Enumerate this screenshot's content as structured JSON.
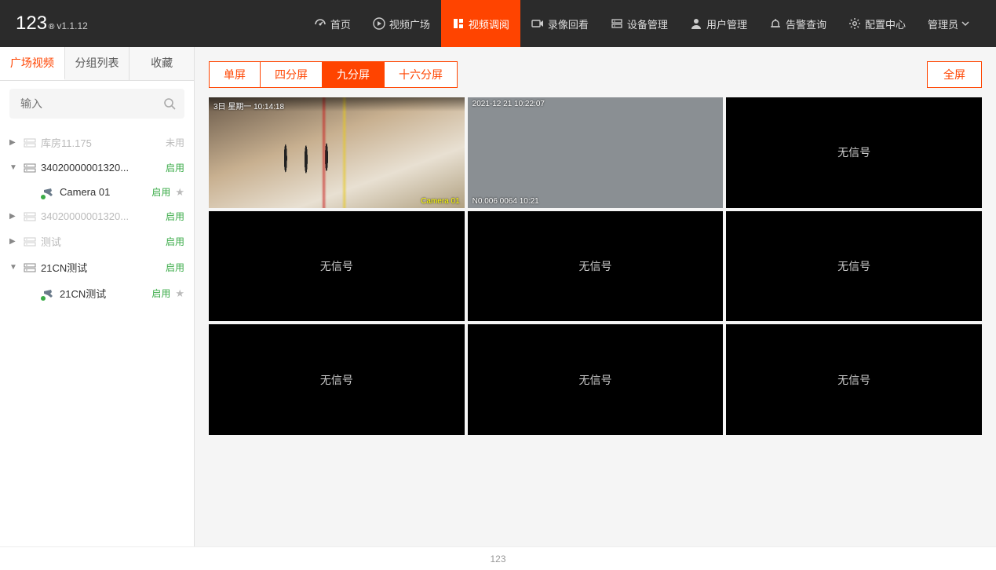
{
  "brand": {
    "name": "123",
    "reg": "®",
    "version": "v1.1.12"
  },
  "nav": {
    "items": [
      {
        "label": "首页",
        "icon": "dashboard"
      },
      {
        "label": "视频广场",
        "icon": "play"
      },
      {
        "label": "视频调阅",
        "icon": "grid",
        "active": true
      },
      {
        "label": "录像回看",
        "icon": "record"
      },
      {
        "label": "设备管理",
        "icon": "device"
      },
      {
        "label": "用户管理",
        "icon": "user"
      },
      {
        "label": "告警查询",
        "icon": "alarm"
      },
      {
        "label": "配置中心",
        "icon": "gear"
      }
    ],
    "user_label": "管理员"
  },
  "sidebar": {
    "tabs": [
      "广场视频",
      "分组列表",
      "收藏"
    ],
    "active_tab": 0,
    "search_placeholder": "输入",
    "tree": [
      {
        "type": "group",
        "label": "库房11.175",
        "status": "未用",
        "status_kind": "grey",
        "expanded": false,
        "dim": true
      },
      {
        "type": "group",
        "label": "34020000001320...",
        "status": "启用",
        "status_kind": "green",
        "expanded": true
      },
      {
        "type": "camera",
        "label": "Camera 01",
        "status": "启用",
        "status_kind": "green",
        "starred": false
      },
      {
        "type": "group",
        "label": "34020000001320...",
        "status": "启用",
        "status_kind": "green",
        "expanded": false,
        "dim": true
      },
      {
        "type": "group",
        "label": "测试",
        "status": "启用",
        "status_kind": "green",
        "expanded": false,
        "dim": true
      },
      {
        "type": "group",
        "label": "21CN测试",
        "status": "启用",
        "status_kind": "green",
        "expanded": true
      },
      {
        "type": "camera",
        "label": "21CN测试",
        "status": "启用",
        "status_kind": "green",
        "starred": false
      }
    ]
  },
  "toolbar": {
    "layouts": [
      "单屏",
      "四分屏",
      "九分屏",
      "十六分屏"
    ],
    "active_layout": 2,
    "fullscreen_label": "全屏"
  },
  "grid": {
    "nosignal_text": "无信号",
    "cells": [
      {
        "kind": "feed1",
        "osd_tl": "3日 星期一 10:14:18",
        "osd_cam": "Camera 01"
      },
      {
        "kind": "feed2",
        "osd_tl": "2021-12  21  10:22:07",
        "osd_bl": "N0.006 0064  10:21",
        "osd_br": ""
      },
      {
        "kind": "nosig"
      },
      {
        "kind": "nosig"
      },
      {
        "kind": "nosig"
      },
      {
        "kind": "nosig"
      },
      {
        "kind": "nosig"
      },
      {
        "kind": "nosig"
      },
      {
        "kind": "nosig"
      }
    ]
  },
  "footer": {
    "text": "123"
  }
}
